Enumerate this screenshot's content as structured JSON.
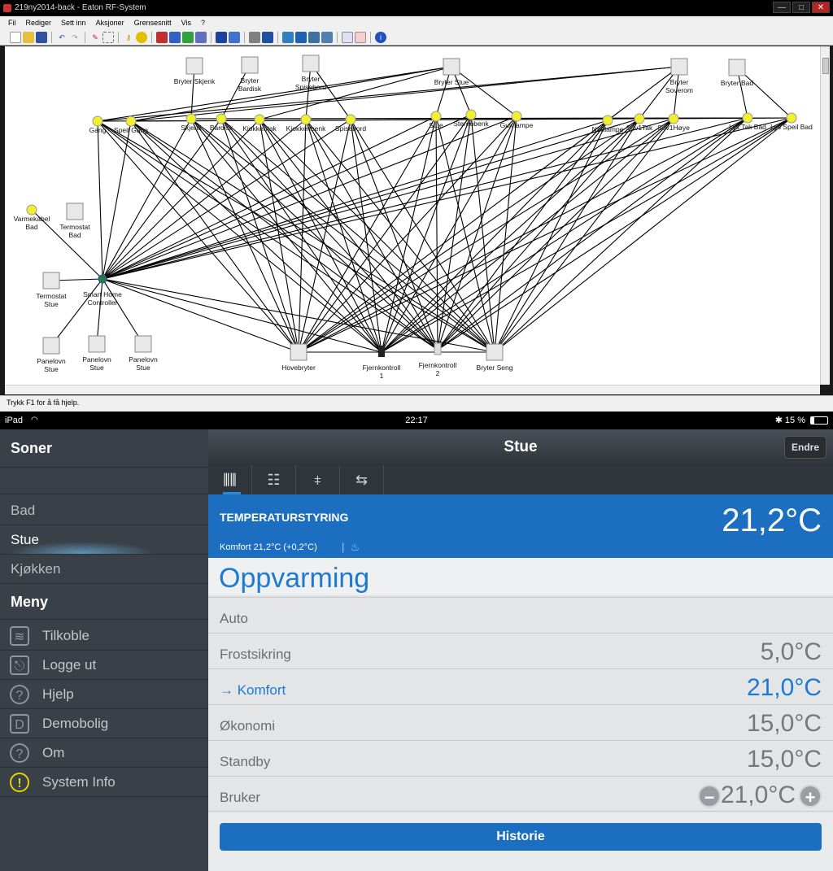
{
  "window": {
    "title": "219ny2014-back - Eaton RF-System",
    "controls": [
      "—",
      "□",
      "✕"
    ]
  },
  "menubar": [
    "Fil",
    "Rediger",
    "Sett inn",
    "Aksjoner",
    "Grensesnitt",
    "Vis",
    "?"
  ],
  "statusbar": {
    "text": "Trykk F1 for å få hjelp."
  },
  "network": {
    "devices": [
      {
        "id": "bryter_skjenk",
        "label": [
          "Bryter Skjenk"
        ],
        "kind": "switch"
      },
      {
        "id": "bryter_bardisk",
        "label": [
          "Bryter",
          "Bardisk"
        ],
        "kind": "switch"
      },
      {
        "id": "bryter_spisebord",
        "label": [
          "Bryter",
          "Spisebord"
        ],
        "kind": "switch"
      },
      {
        "id": "bryter_stue",
        "label": [
          "Bryter Stue"
        ],
        "kind": "switch"
      },
      {
        "id": "bryter_soverom",
        "label": [
          "Bryter",
          "Soverom"
        ],
        "kind": "switch"
      },
      {
        "id": "bryter_bad",
        "label": [
          "Bryter Bad"
        ],
        "kind": "switch"
      },
      {
        "id": "gang",
        "label": [
          "Gang"
        ],
        "kind": "lamp"
      },
      {
        "id": "speil_gang",
        "label": [
          "Speil Gang"
        ],
        "kind": "lamp"
      },
      {
        "id": "skjenk",
        "label": [
          "Skjenk"
        ],
        "kind": "lamp"
      },
      {
        "id": "bardisk",
        "label": [
          "Bardisk"
        ],
        "kind": "lamp"
      },
      {
        "id": "kjokkentak",
        "label": [
          "Kjokkentak"
        ],
        "kind": "lamp"
      },
      {
        "id": "kjokkenbenk",
        "label": [
          "Kjokkenbenk"
        ],
        "kind": "lamp"
      },
      {
        "id": "spisebord",
        "label": [
          "Spisebord"
        ],
        "kind": "lamp"
      },
      {
        "id": "stue",
        "label": [
          "Stue"
        ],
        "kind": "lamp"
      },
      {
        "id": "stereobenk",
        "label": [
          "Stereobenk"
        ],
        "kind": "lamp"
      },
      {
        "id": "gulvlampe",
        "label": [
          "Gulvlampe"
        ],
        "kind": "lamp"
      },
      {
        "id": "nattlampe",
        "label": [
          "Nattlampe"
        ],
        "kind": "lamp"
      },
      {
        "id": "sov1tak",
        "label": [
          "Sov1Tak"
        ],
        "kind": "lamp"
      },
      {
        "id": "sov1hoye",
        "label": [
          "Sov1Høye"
        ],
        "kind": "lamp"
      },
      {
        "id": "lys_tak_bad",
        "label": [
          "Lys Tak Bad"
        ],
        "kind": "lamp"
      },
      {
        "id": "lys_speil_bad",
        "label": [
          "Lys Speil Bad"
        ],
        "kind": "lamp"
      },
      {
        "id": "varmekabel_bad",
        "label": [
          "Varmekabel",
          "Bad"
        ],
        "kind": "lamp"
      },
      {
        "id": "termostat_bad",
        "label": [
          "Termostat",
          "Bad"
        ],
        "kind": "thermostat"
      },
      {
        "id": "termostat_stue",
        "label": [
          "Termostat",
          "Stue"
        ],
        "kind": "thermostat"
      },
      {
        "id": "shc",
        "label": [
          "Smart Home",
          "Controller"
        ],
        "kind": "controller"
      },
      {
        "id": "panelovn1",
        "label": [
          "Panelovn",
          "Stue"
        ],
        "kind": "heater"
      },
      {
        "id": "panelovn2",
        "label": [
          "Panelovn",
          "Stue"
        ],
        "kind": "heater"
      },
      {
        "id": "panelovn3",
        "label": [
          "Panelovn",
          "Stue"
        ],
        "kind": "heater"
      },
      {
        "id": "hovebryter",
        "label": [
          "Hovebryter"
        ],
        "kind": "switch"
      },
      {
        "id": "fjernkontroll1",
        "label": [
          "Fjernkontroll",
          "1"
        ],
        "kind": "remote"
      },
      {
        "id": "fjernkontroll2",
        "label": [
          "Fjernkontroll",
          "2"
        ],
        "kind": "remote2"
      },
      {
        "id": "bryter_seng",
        "label": [
          "Bryter Seng"
        ],
        "kind": "switch"
      }
    ]
  },
  "ios_status": {
    "device": "iPad",
    "time": "22:17",
    "battery": "15 %"
  },
  "sidebar": {
    "zones_title": "Soner",
    "zones": [
      {
        "label": "Bad",
        "selected": false
      },
      {
        "label": "Stue",
        "selected": true
      },
      {
        "label": "Kjøkken",
        "selected": false
      }
    ],
    "menu_title": "Meny",
    "menu": [
      {
        "label": "Tilkoble",
        "icon": "wifi-icon"
      },
      {
        "label": "Logge ut",
        "icon": "logout-icon"
      },
      {
        "label": "Hjelp",
        "icon": "help-icon"
      },
      {
        "label": "Demobolig",
        "icon": "house-icon"
      },
      {
        "label": "Om",
        "icon": "about-icon"
      },
      {
        "label": "System Info",
        "icon": "warning-icon"
      }
    ]
  },
  "main": {
    "title": "Stue",
    "edit_label": "Endre",
    "tabs": [
      "heater-icon",
      "grid-icon",
      "sliders-icon",
      "shuffle-icon"
    ],
    "header": {
      "label": "TEMPERATURSTYRING",
      "temperature": "21,2°C",
      "sub": "Komfort 21,2°C (+0,2°C)"
    },
    "section_title": "Oppvarming",
    "modes": [
      {
        "label": "Auto",
        "value": "",
        "selected": false
      },
      {
        "label": "Frostsikring",
        "value": "5,0°C",
        "selected": false
      },
      {
        "label": "→ Komfort",
        "value": "21,0°C",
        "selected": true
      },
      {
        "label": "Økonomi",
        "value": "15,0°C",
        "selected": false
      },
      {
        "label": "Standby",
        "value": "15,0°C",
        "selected": false
      },
      {
        "label": "Bruker",
        "value": "21,0°C",
        "selected": false
      }
    ],
    "history_label": "Historie"
  },
  "colors": {
    "accent": "#1c6fc0",
    "sidebar": "#3a4048",
    "selected_text": "#1d7ad0"
  }
}
